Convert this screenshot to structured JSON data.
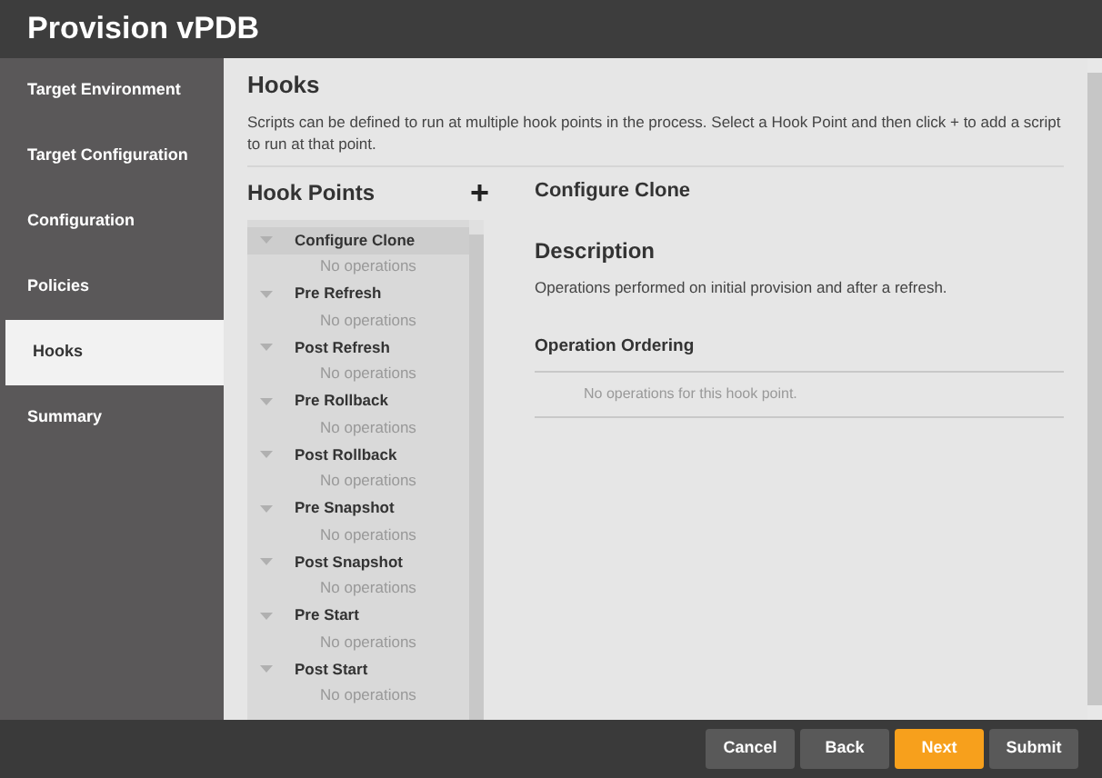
{
  "window": {
    "title": "Provision vPDB"
  },
  "sidebar": {
    "items": [
      {
        "label": "Target Environment",
        "selected": false
      },
      {
        "label": "Target Configuration",
        "selected": false
      },
      {
        "label": "Configuration",
        "selected": false
      },
      {
        "label": "Policies",
        "selected": false
      },
      {
        "label": "Hooks",
        "selected": true
      },
      {
        "label": "Summary",
        "selected": false
      }
    ]
  },
  "section": {
    "title": "Hooks",
    "description": "Scripts can be defined to run at multiple hook points in the process. Select a Hook Point and then click + to add a script to run at that point."
  },
  "hook_points": {
    "title": "Hook Points",
    "add": "+",
    "items": [
      {
        "label": "Configure Clone",
        "selected": true,
        "expanded": true,
        "operations": "No operations"
      },
      {
        "label": "Pre Refresh",
        "selected": false,
        "expanded": true,
        "operations": "No operations"
      },
      {
        "label": "Post Refresh",
        "selected": false,
        "expanded": true,
        "operations": "No operations"
      },
      {
        "label": "Pre Rollback",
        "selected": false,
        "expanded": true,
        "operations": "No operations"
      },
      {
        "label": "Post Rollback",
        "selected": false,
        "expanded": true,
        "operations": "No operations"
      },
      {
        "label": "Pre Snapshot",
        "selected": false,
        "expanded": true,
        "operations": "No operations"
      },
      {
        "label": "Post Snapshot",
        "selected": false,
        "expanded": true,
        "operations": "No operations"
      },
      {
        "label": "Pre Start",
        "selected": false,
        "expanded": true,
        "operations": "No operations"
      },
      {
        "label": "Post Start",
        "selected": false,
        "expanded": true,
        "operations": "No operations"
      }
    ]
  },
  "detail": {
    "title": "Configure Clone",
    "description_heading": "Description",
    "description": "Operations performed on initial provision and after a refresh.",
    "ordering_heading": "Operation Ordering",
    "ordering_empty": "No operations for this hook point."
  },
  "buttons": [
    {
      "label": "Cancel",
      "kind": "secondary"
    },
    {
      "label": "Back",
      "kind": "secondary"
    },
    {
      "label": "Next",
      "kind": "primary"
    },
    {
      "label": "Submit",
      "kind": "secondary"
    }
  ]
}
